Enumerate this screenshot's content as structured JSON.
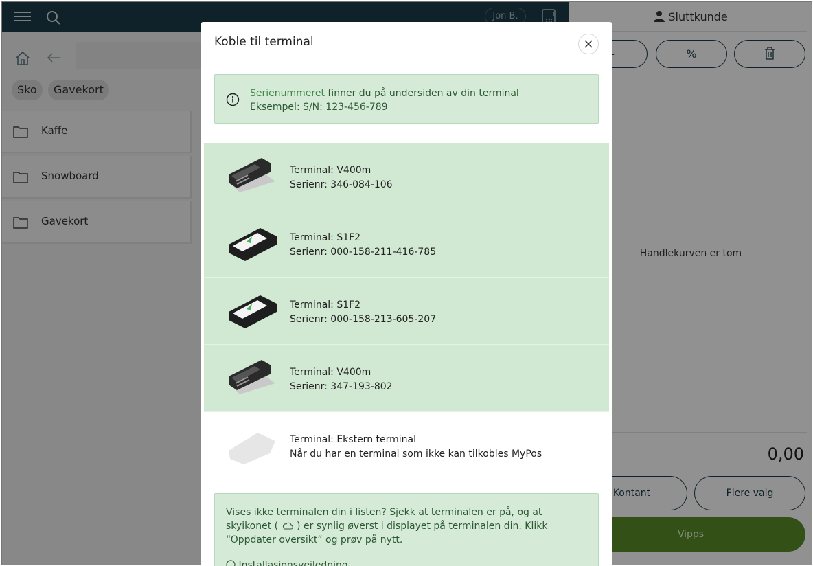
{
  "topbar": {
    "user": "Jon B."
  },
  "chips": [
    "Sko",
    "Gavekort"
  ],
  "folders": [
    "Kaffe",
    "Snowboard",
    "Gavekort"
  ],
  "cart": {
    "customer": "Sluttkunde",
    "discount_symbol": "%",
    "empty_text": "Handlekurven er tom",
    "total": "0,00",
    "cash_label": "Kontant",
    "more_label": "Flere valg",
    "vipps_label": "Vipps"
  },
  "modal": {
    "title": "Koble til terminal",
    "close": "×",
    "info_link": "Serienummeret",
    "info_line1_rest": " finner du på undersiden av din terminal",
    "info_line2": "Eksempel: S/N: 123-456-789",
    "terminals": [
      {
        "name": "Terminal: V400m",
        "detail": "Serienr: 346-084-106"
      },
      {
        "name": "Terminal: S1F2",
        "detail": "Serienr: 000-158-211-416-785"
      },
      {
        "name": "Terminal: S1F2",
        "detail": "Serienr: 000-158-213-605-207"
      },
      {
        "name": "Terminal: V400m",
        "detail": "Serienr: 347-193-802"
      },
      {
        "name": "Terminal: Ekstern terminal",
        "detail": "Når du har en terminal som ikke kan tilkobles MyPos"
      }
    ],
    "help_text_a": "Vises ikke terminalen din i listen? Sjekk at terminalen er på, og at skyikonet (",
    "help_text_b": ") er synlig øverst i displayet på terminalen din. Klikk “Oppdater oversikt” og prøv på nytt.",
    "help_link": "Installasjonsveiledning"
  },
  "colors": {
    "topbar": "#1c3a48",
    "online_row": "#d1e8d3",
    "info_bg": "#d5ebd8",
    "vipps": "#5a8f2a"
  }
}
